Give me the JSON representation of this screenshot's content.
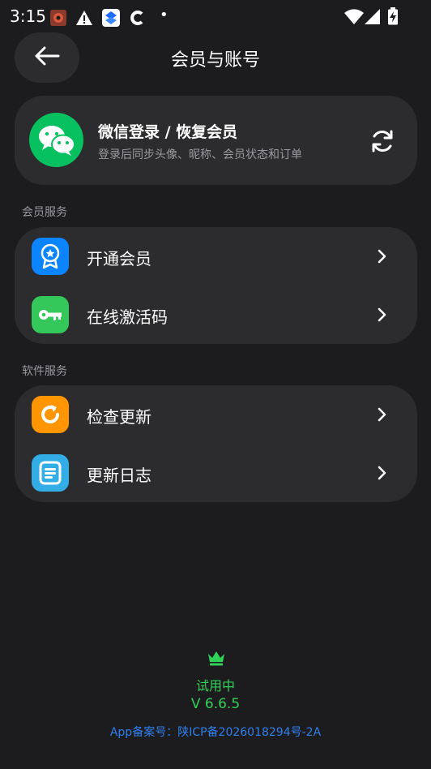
{
  "status_bar": {
    "time": "3:15",
    "dot": "•",
    "icons": [
      "app-notification-icon",
      "warning-icon",
      "layers-app-icon",
      "c-app-icon",
      "dot-icon",
      "wifi-icon",
      "signal-icon",
      "battery-charging-icon"
    ]
  },
  "header": {
    "title": "会员与账号",
    "back_icon": "arrow-left-icon"
  },
  "login_card": {
    "title": "微信登录 / 恢复会员",
    "subtitle": "登录后同步头像、昵称、会员状态和订单",
    "logo_icon": "wechat-icon",
    "action_icon": "refresh-icon"
  },
  "sections": {
    "member": {
      "label": "会员服务",
      "items": [
        {
          "label": "开通会员",
          "icon": "member-badge-icon",
          "color": "#0a84ff"
        },
        {
          "label": "在线激活码",
          "icon": "key-icon",
          "color": "#34c759"
        }
      ]
    },
    "software": {
      "label": "软件服务",
      "items": [
        {
          "label": "检查更新",
          "icon": "refresh-update-icon",
          "color": "#ff9500"
        },
        {
          "label": "更新日志",
          "icon": "document-list-icon",
          "color": "#32ade6"
        }
      ]
    }
  },
  "footer": {
    "crown_icon": "crown-icon",
    "status": "试用中",
    "version": "V 6.6.5",
    "icp": "App备案号：陕ICP备2026018294号-2A"
  },
  "colors": {
    "background": "#1c1c1e",
    "card": "#2c2c2e",
    "accent_green": "#30d158",
    "link_blue": "#2f80ed",
    "wechat_green": "#07c160"
  }
}
